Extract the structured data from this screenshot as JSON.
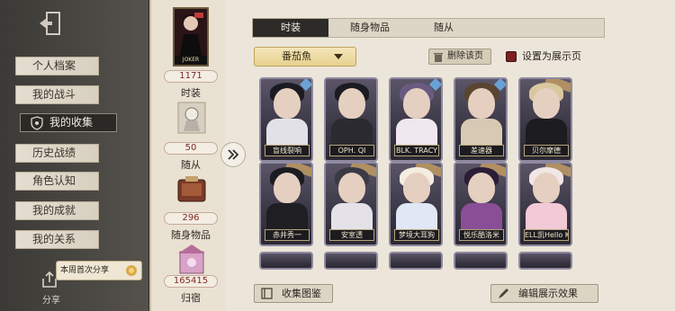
{
  "sidebar": {
    "items": [
      {
        "label": "个人档案"
      },
      {
        "label": "我的战斗"
      },
      {
        "label": "我的收集"
      },
      {
        "label": "历史战绩"
      },
      {
        "label": "角色认知"
      },
      {
        "label": "我的成就"
      },
      {
        "label": "我的关系"
      }
    ],
    "active_index": 2,
    "share_label": "分享",
    "share_popup": "本周首次分享"
  },
  "stats": {
    "portrait_label": "JOKER",
    "costume_count": "1171",
    "costume_label": "时装",
    "follower_count": "50",
    "follower_label": "随从",
    "item_count": "296",
    "item_label": "随身物品",
    "home_count": "165415",
    "home_label": "归宿"
  },
  "tabs": [
    {
      "label": "时装"
    },
    {
      "label": "随身物品"
    },
    {
      "label": "随从"
    }
  ],
  "toolbar": {
    "dropdown_value": "番茄魚",
    "delete_label": "删除该页",
    "showcase_label": "设置为展示页"
  },
  "cards_row1": [
    {
      "name": "盲线裂响"
    },
    {
      "name": "OPH. QI"
    },
    {
      "name": "BLK. TRACY"
    },
    {
      "name": "差速器"
    },
    {
      "name": "贝尔摩德"
    }
  ],
  "cards_row2": [
    {
      "name": "赤井秀一"
    },
    {
      "name": "安室透"
    },
    {
      "name": "梦境大耳狗"
    },
    {
      "name": "悦乐酷洛米"
    },
    {
      "name": "ELL凯Hello Kitty"
    }
  ],
  "bottom": {
    "album_label": "收集图鉴",
    "edit_label": "编辑展示效果"
  },
  "colors": {
    "active_bg": "#2d2b28",
    "accent_gold": "#e8d291",
    "stat_red": "#7b2a26"
  }
}
